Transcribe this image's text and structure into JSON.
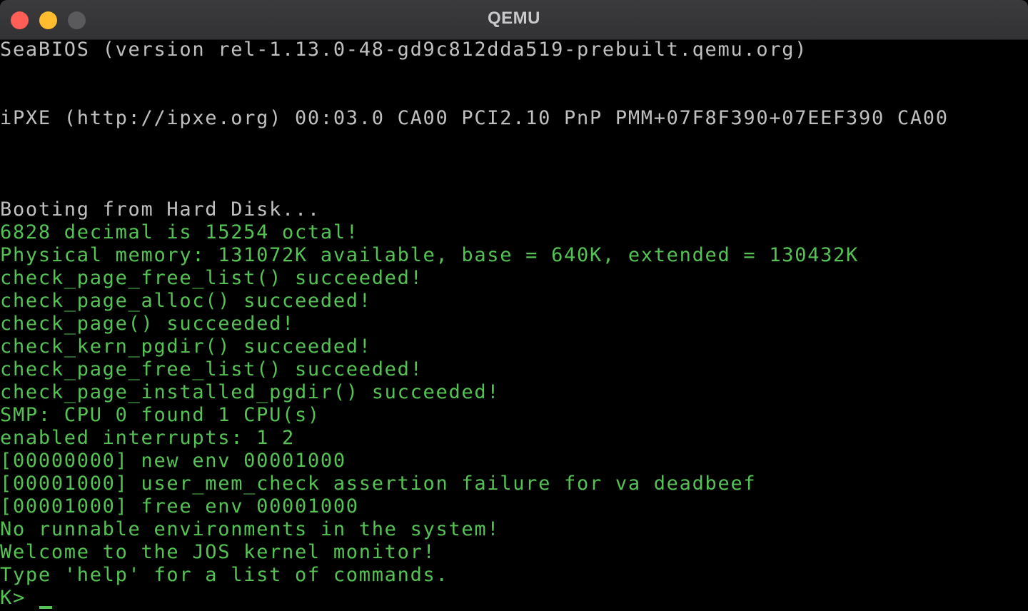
{
  "window": {
    "title": "QEMU",
    "controls": {
      "close_color": "#ff5f57",
      "minimize_color": "#febc2e",
      "zoom_color": "#5a5a5c"
    }
  },
  "colors": {
    "bios_text": "#c0c0c0",
    "kernel_text": "#54c354",
    "background": "#000000"
  },
  "console": {
    "bios_lines": [
      "SeaBIOS (version rel-1.13.0-48-gd9c812dda519-prebuilt.qemu.org)",
      "iPXE (http://ipxe.org) 00:03.0 CA00 PCI2.10 PnP PMM+07F8F390+07EEF390 CA00",
      "Booting from Hard Disk..."
    ],
    "kernel_lines": [
      "6828 decimal is 15254 octal!",
      "Physical memory: 131072K available, base = 640K, extended = 130432K",
      "check_page_free_list() succeeded!",
      "check_page_alloc() succeeded!",
      "check_page() succeeded!",
      "check_kern_pgdir() succeeded!",
      "check_page_free_list() succeeded!",
      "check_page_installed_pgdir() succeeded!",
      "SMP: CPU 0 found 1 CPU(s)",
      "enabled interrupts: 1 2",
      "[00000000] new env 00001000",
      "[00001000] user_mem_check assertion failure for va deadbeef",
      "[00001000] free env 00001000",
      "No runnable environments in the system!",
      "Welcome to the JOS kernel monitor!",
      "Type 'help' for a list of commands."
    ],
    "prompt": "K> "
  }
}
